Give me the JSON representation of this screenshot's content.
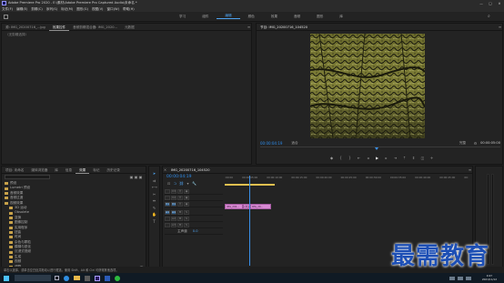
{
  "window": {
    "title": "Adobe Premiere Pro 2020 - E:\\素材\\Adobe Premiere Pro Captured Audio\\未命名 *",
    "controls": [
      "—",
      "□",
      "✕"
    ]
  },
  "menu": [
    "文件(F)",
    "编辑(E)",
    "剪辑(C)",
    "序列(S)",
    "标记(M)",
    "图形(G)",
    "视图(V)",
    "窗口(W)",
    "帮助(H)"
  ],
  "workspaces": [
    "学习",
    "组件",
    "编辑",
    "颜色",
    "效果",
    "音频",
    "图形",
    "库"
  ],
  "workspaces_active_index": 2,
  "source_panel": {
    "tabs": [
      "源: IMG_20200716_...jpg",
      "效果控件",
      "音频剪辑混合器: IMG_2020...",
      "元数据"
    ],
    "active_tab": 1,
    "header": "（无剪辑选择）"
  },
  "program_monitor": {
    "tab": "节目: IMG_20200716_104520",
    "timecode": "00:00:04:19",
    "fit": "适合",
    "quality": "完整",
    "duration": "00:00:05:00"
  },
  "project_panel": {
    "tabs": [
      "项目: 未命名",
      "媒体浏览器",
      "库",
      "信息",
      "效果",
      "标记",
      "历史记录"
    ],
    "active_tab": 4,
    "search_placeholder": "",
    "tree": [
      {
        "label": "预设",
        "level": 0
      },
      {
        "label": "Lumetri 预设",
        "level": 0
      },
      {
        "label": "音频效果",
        "level": 0
      },
      {
        "label": "音频过渡",
        "level": 0
      },
      {
        "label": "视频效果",
        "level": 0
      },
      {
        "label": "3D 运动",
        "level": 1
      },
      {
        "label": "Obsolete",
        "level": 1
      },
      {
        "label": "变换",
        "level": 1
      },
      {
        "label": "图像控制",
        "level": 1
      },
      {
        "label": "实用程序",
        "level": 1
      },
      {
        "label": "扭曲",
        "level": 1
      },
      {
        "label": "时间",
        "level": 1
      },
      {
        "label": "杂色与颗粒",
        "level": 1
      },
      {
        "label": "模糊与锐化",
        "level": 1
      },
      {
        "label": "沉浸式视频",
        "level": 1
      },
      {
        "label": "生成",
        "level": 1
      },
      {
        "label": "视频",
        "level": 1
      },
      {
        "label": "调整",
        "level": 1
      },
      {
        "label": "过时",
        "level": 1
      },
      {
        "label": "过渡",
        "level": 1
      },
      {
        "label": "透视",
        "level": 1
      },
      {
        "label": "通道",
        "level": 1
      },
      {
        "label": "键控",
        "level": 1
      },
      {
        "label": "颜色校正",
        "level": 1
      },
      {
        "label": "风格化",
        "level": 1
      },
      {
        "label": "浮雕",
        "level": 2,
        "selected": true
      },
      {
        "label": "视频过渡",
        "level": 0
      }
    ]
  },
  "timeline": {
    "tab": "IMG_20200716_104520",
    "timecode": "00:00:04:19",
    "ruler": [
      ":00:00",
      "00:00:05:00",
      "00:00:10:00",
      "00:00:15:00",
      "00:00:20:00",
      "00:00:25:00",
      "00:00:30:00",
      "00:00:35:00",
      "00:00:40:00",
      "00:00:45:00",
      "00:"
    ],
    "video_tracks": [
      "V3",
      "V2",
      "V1"
    ],
    "audio_tracks": [
      "A1",
      "A2",
      "A3"
    ],
    "master": {
      "label": "主声道",
      "value": "0.0"
    },
    "clips": [
      {
        "label": "IMG_202...",
        "track": "V1",
        "start": 0.0,
        "end": 3.5
      },
      {
        "label": "[交叉溶解]",
        "track": "V1",
        "start": 3.5,
        "end": 5.0
      },
      {
        "label": "IMG_20...",
        "track": "V1",
        "start": 5.0,
        "end": 9.2
      }
    ],
    "playhead_seconds": 4.79,
    "total_seconds": 48
  },
  "status": {
    "message": "单击以选择，或单击空白处并拖动以进行框选。使用 Shift、Alt 和 Ctrl 可获得其他选项。"
  },
  "watermark": "最需教育",
  "taskbar": {
    "icons": [
      "windows-logo",
      "search",
      "task-view",
      "ie",
      "folder",
      "store",
      "premiere",
      "word",
      "wechat"
    ],
    "time": "9:47",
    "date": "2021/11/12"
  },
  "colors": {
    "accent": "#2d8ceb",
    "clip": "#d98ad4",
    "playhead": "#3a8fe8"
  }
}
